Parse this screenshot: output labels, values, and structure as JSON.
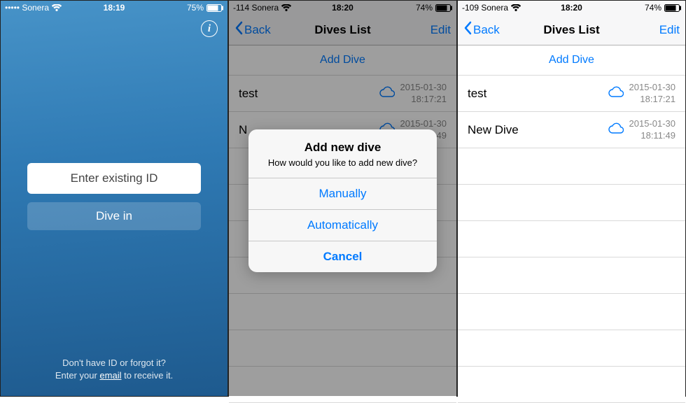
{
  "screen1": {
    "status": {
      "signal": "••••• Sonera",
      "wifi": true,
      "time": "18:19",
      "battery_pct": "75%"
    },
    "info_icon_label": "i",
    "input_placeholder": "Enter existing ID",
    "dive_in_label": "Dive in",
    "footer_line1": "Don't have ID or forgot it?",
    "footer_prefix": "Enter your ",
    "footer_email": "email",
    "footer_suffix": " to receive it."
  },
  "screen2": {
    "status": {
      "signal": "-114 Sonera",
      "wifi": true,
      "time": "18:20",
      "battery_pct": "74%"
    },
    "nav": {
      "back": "Back",
      "title": "Dives List",
      "edit": "Edit"
    },
    "add_dive_label": "Add Dive",
    "dives": [
      {
        "name": "test",
        "date": "2015-01-30",
        "time": "18:17:21"
      },
      {
        "name": "N",
        "date": "2015-01-30",
        "time": "49"
      }
    ],
    "alert": {
      "title": "Add new dive",
      "message": "How would you like to add new dive?",
      "opt1": "Manually",
      "opt2": "Automatically",
      "cancel": "Cancel"
    }
  },
  "screen3": {
    "status": {
      "signal": "-109 Sonera",
      "wifi": true,
      "time": "18:20",
      "battery_pct": "74%"
    },
    "nav": {
      "back": "Back",
      "title": "Dives List",
      "edit": "Edit"
    },
    "add_dive_label": "Add Dive",
    "dives": [
      {
        "name": "test",
        "date": "2015-01-30",
        "time": "18:17:21"
      },
      {
        "name": "New Dive",
        "date": "2015-01-30",
        "time": "18:11:49"
      }
    ]
  }
}
